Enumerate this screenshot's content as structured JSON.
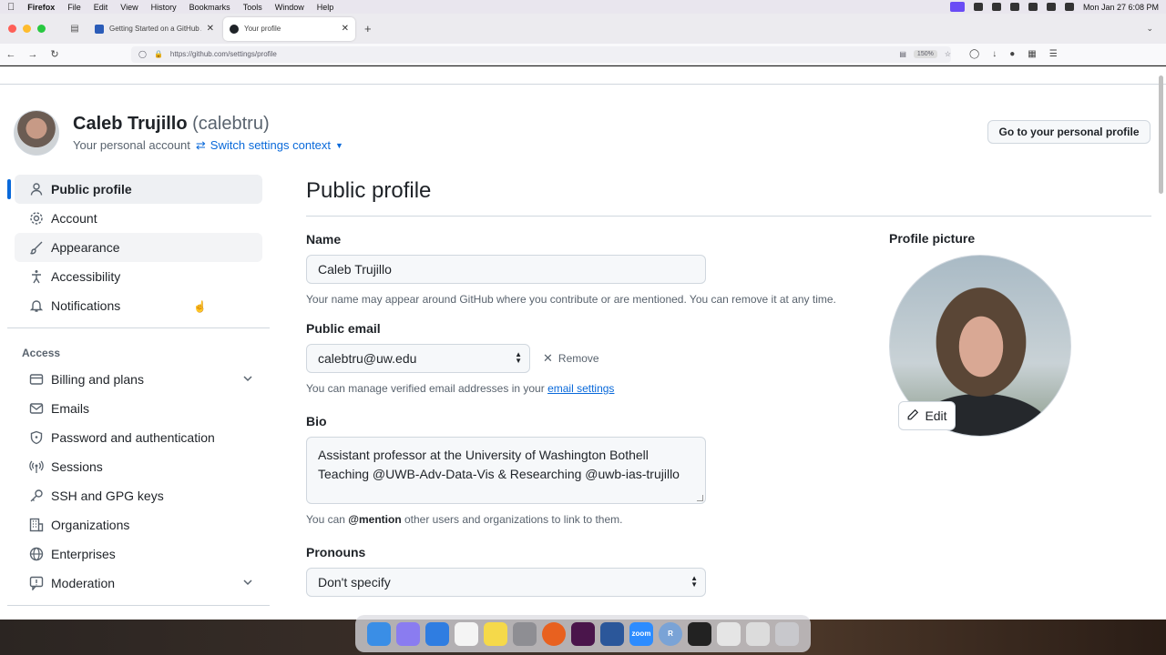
{
  "menubar": {
    "app": "Firefox",
    "items": [
      "File",
      "Edit",
      "View",
      "History",
      "Bookmarks",
      "Tools",
      "Window",
      "Help"
    ],
    "datetime": "Mon Jan 27  6:08 PM"
  },
  "browser": {
    "tabs": [
      {
        "label": "Getting Started on a GitHub As"
      },
      {
        "label": "Your profile"
      }
    ],
    "url": "https://github.com/settings/profile",
    "zoom": "150%"
  },
  "account": {
    "name": "Caleb Trujillo",
    "login": "(calebtru)",
    "subtitle": "Your personal account",
    "switch_label": "Switch settings context",
    "go_profile": "Go to your personal profile"
  },
  "sidebar": {
    "items": [
      {
        "label": "Public profile",
        "icon": "person-icon"
      },
      {
        "label": "Account",
        "icon": "gear-icon"
      },
      {
        "label": "Appearance",
        "icon": "paintbrush-icon"
      },
      {
        "label": "Accessibility",
        "icon": "accessibility-icon"
      },
      {
        "label": "Notifications",
        "icon": "bell-icon"
      }
    ],
    "section": "Access",
    "access_items": [
      {
        "label": "Billing and plans",
        "icon": "credit-card-icon"
      },
      {
        "label": "Emails",
        "icon": "mail-icon"
      },
      {
        "label": "Password and authentication",
        "icon": "shield-icon"
      },
      {
        "label": "Sessions",
        "icon": "broadcast-icon"
      },
      {
        "label": "SSH and GPG keys",
        "icon": "key-icon"
      },
      {
        "label": "Organizations",
        "icon": "organization-icon"
      },
      {
        "label": "Enterprises",
        "icon": "globe-icon"
      },
      {
        "label": "Moderation",
        "icon": "report-icon"
      }
    ]
  },
  "main": {
    "title": "Public profile",
    "name_label": "Name",
    "name_value": "Caleb Trujillo",
    "name_note": "Your name may appear around GitHub where you contribute or are mentioned. You can remove it at any time.",
    "email_label": "Public email",
    "email_value": "calebtru@uw.edu",
    "remove_label": "Remove",
    "email_note_prefix": "You can manage verified email addresses in your",
    "email_note_link": "email settings",
    "bio_label": "Bio",
    "bio_line1": "Assistant professor at the University of Washington Bothell",
    "bio_line2": "Teaching @UWB-Adv-Data-Vis & Researching @uwb-ias-trujillo",
    "bio_note_prefix": "You can",
    "bio_note_mention": "@mention",
    "bio_note_suffix": "other users and organizations to link to them.",
    "pronouns_label": "Pronouns",
    "pronouns_value": "Don't specify",
    "picture_label": "Profile picture",
    "edit_label": "Edit"
  },
  "dock": {
    "zoom_label": "zoom",
    "r_label": "R"
  },
  "colors": {
    "accent": "#0969da",
    "text": "#1f2328",
    "muted": "#59636e",
    "border": "#d0d7de"
  }
}
